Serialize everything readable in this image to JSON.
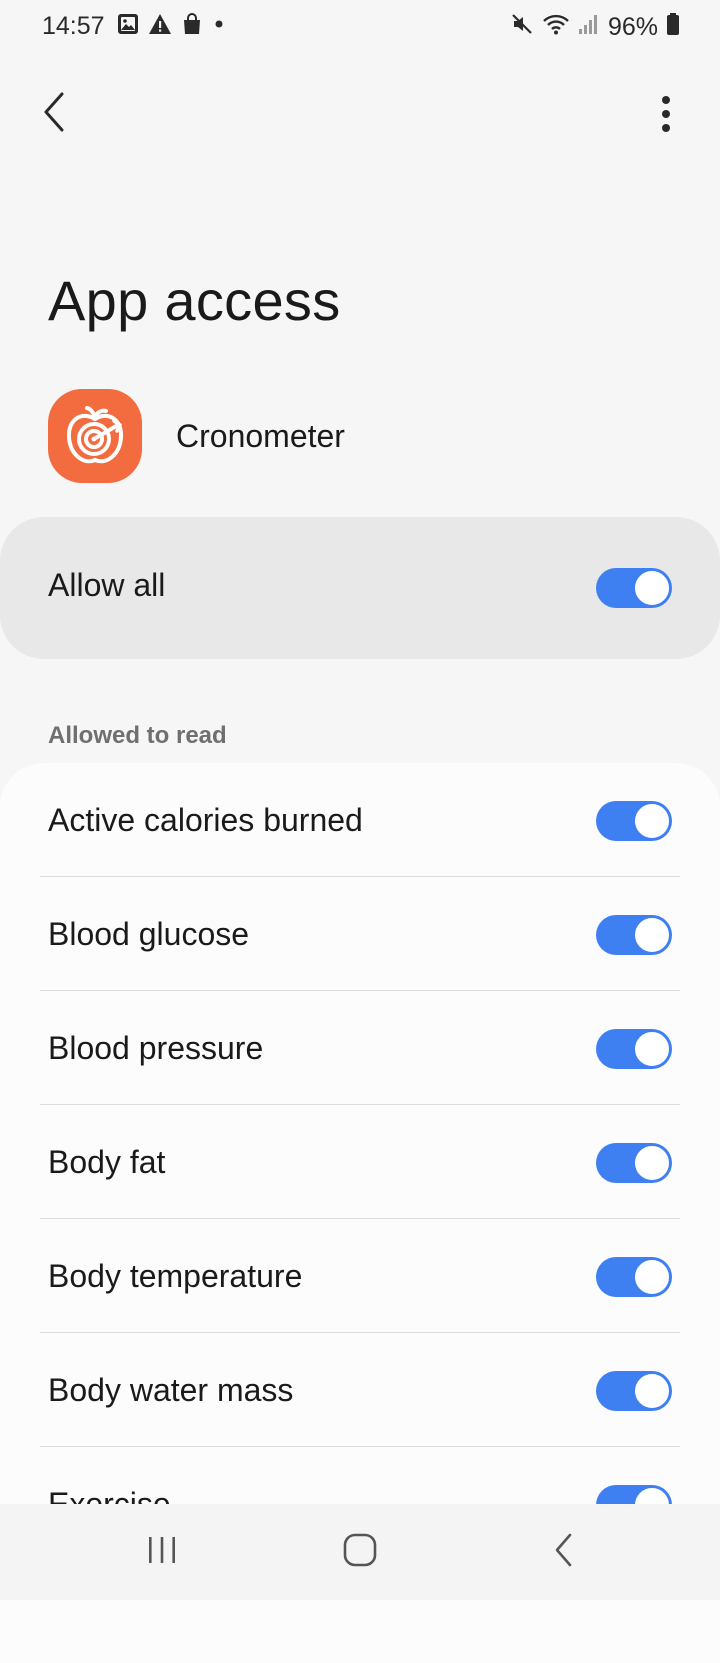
{
  "status_bar": {
    "time": "14:57",
    "battery": "96%",
    "left_icons": [
      "gallery-icon",
      "warning-icon",
      "shopping-bag-icon",
      "dot-icon"
    ],
    "right_icons": [
      "mute-icon",
      "wifi-icon",
      "signal-icon",
      "battery-icon"
    ]
  },
  "header": {
    "back_icon": "back-arrow-icon",
    "more_icon": "more-options-icon",
    "title": "App access"
  },
  "app": {
    "name": "Cronometer",
    "icon": "cronometer-apple-target-icon",
    "icon_color": "#f26c3f"
  },
  "allow_all": {
    "label": "Allow all",
    "enabled": true
  },
  "section": {
    "title": "Allowed to read"
  },
  "permissions": [
    {
      "label": "Active calories burned",
      "enabled": true
    },
    {
      "label": "Blood glucose",
      "enabled": true
    },
    {
      "label": "Blood pressure",
      "enabled": true
    },
    {
      "label": "Body fat",
      "enabled": true
    },
    {
      "label": "Body temperature",
      "enabled": true
    },
    {
      "label": "Body water mass",
      "enabled": true
    },
    {
      "label": "Exercise",
      "enabled": true
    }
  ],
  "nav_bar": {
    "recents_icon": "recents-icon",
    "home_icon": "home-icon",
    "back_icon": "nav-back-icon"
  },
  "colors": {
    "accent": "#3e7ff1",
    "background": "#f6f6f6",
    "card": "#fcfcfc",
    "allow_all_card": "#e8e8e8"
  }
}
